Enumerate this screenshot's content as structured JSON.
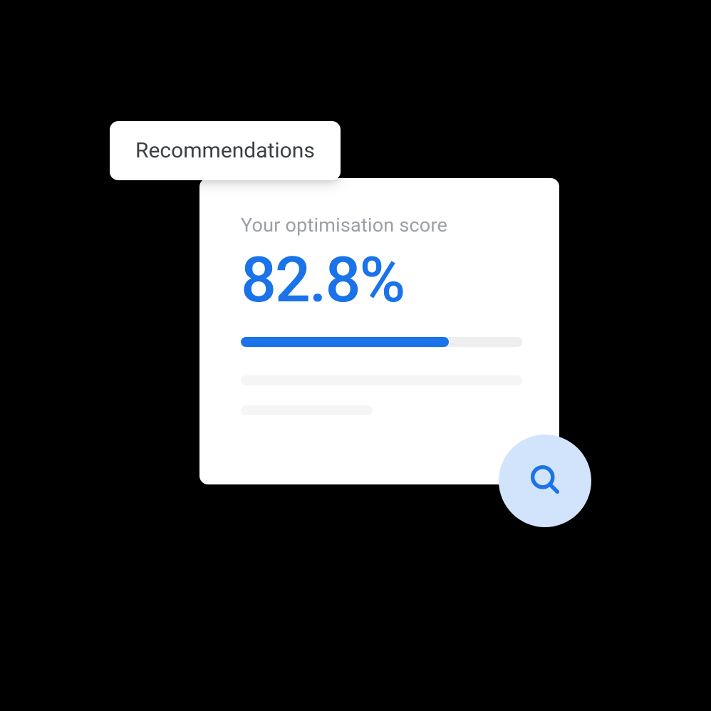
{
  "chip": {
    "label": "Recommendations"
  },
  "card": {
    "subtitle": "Your optimisation score",
    "score": "82.8%",
    "progress_percent": 74
  },
  "colors": {
    "accent": "#1a73e8",
    "light_blue": "#d2e3fc",
    "text_gray": "#9aa0a6",
    "text_dark": "#3c4043"
  }
}
